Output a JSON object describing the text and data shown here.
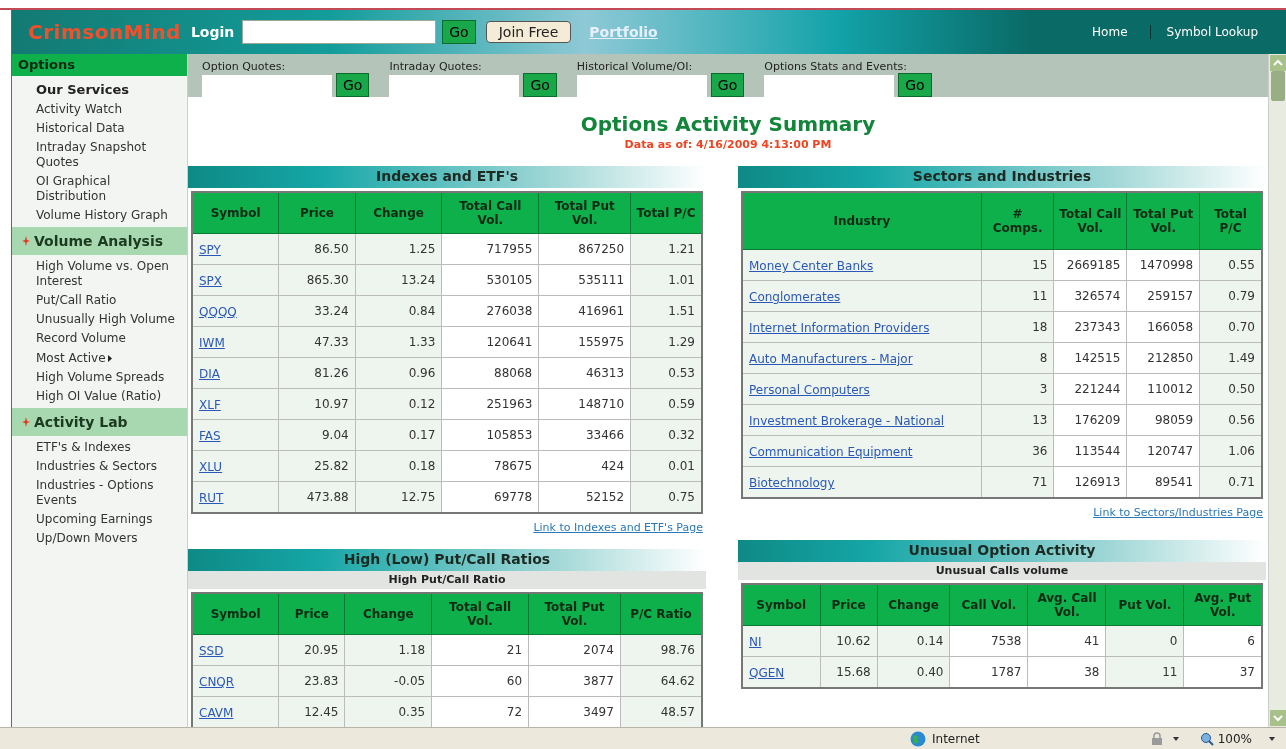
{
  "header": {
    "logo": "CrimsonMind",
    "login_label": "Login",
    "login_button": "Go",
    "join_button": "Join Free",
    "portfolio_link": "Portfolio",
    "nav_links": [
      "Home",
      "Symbol Lookup"
    ]
  },
  "sidebar": {
    "title": "Options",
    "items": [
      {
        "kind": "heading",
        "label": "Our Services"
      },
      {
        "kind": "link",
        "label": "Activity Watch"
      },
      {
        "kind": "link",
        "label": "Historical Data"
      },
      {
        "kind": "link",
        "label": "Intraday Snapshot Quotes"
      },
      {
        "kind": "link",
        "label": "OI Graphical Distribution"
      },
      {
        "kind": "link",
        "label": "Volume History Graph"
      },
      {
        "kind": "section",
        "label": "Volume Analysis"
      },
      {
        "kind": "link",
        "label": "High Volume vs. Open Interest"
      },
      {
        "kind": "link",
        "label": "Put/Call Ratio"
      },
      {
        "kind": "link",
        "label": "Unusually High Volume"
      },
      {
        "kind": "link",
        "label": "Record Volume"
      },
      {
        "kind": "submenu",
        "label": "Most Active"
      },
      {
        "kind": "link",
        "label": "High Volume Spreads"
      },
      {
        "kind": "link",
        "label": "High OI Value (Ratio)"
      },
      {
        "kind": "section",
        "label": "Activity Lab"
      },
      {
        "kind": "link",
        "label": "ETF's & Indexes"
      },
      {
        "kind": "link",
        "label": "Industries & Sectors"
      },
      {
        "kind": "link",
        "label": "Industries - Options Events"
      },
      {
        "kind": "link",
        "label": "Upcoming Earnings"
      },
      {
        "kind": "link",
        "label": "Up/Down Movers"
      }
    ]
  },
  "quote_bar": [
    {
      "label": "Option Quotes:",
      "button": "Go"
    },
    {
      "label": "Intraday Quotes:",
      "button": "Go"
    },
    {
      "label": "Historical Volume/OI:",
      "button": "Go"
    },
    {
      "label": "Options Stats and Events:",
      "button": "Go"
    }
  ],
  "summary": {
    "title": "Options Activity Summary",
    "date": "Data as of: 4/16/2009 4:13:00 PM"
  },
  "left_tables": [
    {
      "title": "Indexes and ETF's",
      "columns": [
        "Symbol",
        "Price",
        "Change",
        "Total Call Vol.",
        "Total Put Vol.",
        "Total P/C"
      ],
      "rows": [
        [
          "SPY",
          "86.50",
          "1.25",
          "717955",
          "867250",
          "1.21"
        ],
        [
          "SPX",
          "865.30",
          "13.24",
          "530105",
          "535111",
          "1.01"
        ],
        [
          "QQQQ",
          "33.24",
          "0.84",
          "276038",
          "416961",
          "1.51"
        ],
        [
          "IWM",
          "47.33",
          "1.33",
          "120641",
          "155975",
          "1.29"
        ],
        [
          "DIA",
          "81.26",
          "0.96",
          "88068",
          "46313",
          "0.53"
        ],
        [
          "XLF",
          "10.97",
          "0.12",
          "251963",
          "148710",
          "0.59"
        ],
        [
          "FAS",
          "9.04",
          "0.17",
          "105853",
          "33466",
          "0.32"
        ],
        [
          "XLU",
          "25.82",
          "0.18",
          "78675",
          "424",
          "0.01"
        ],
        [
          "RUT",
          "473.88",
          "12.75",
          "69778",
          "52152",
          "0.75"
        ]
      ],
      "link": "Link to Indexes and ETF's Page"
    },
    {
      "title": "High (Low) Put/Call Ratios",
      "subtitle": "High Put/Call Ratio",
      "columns": [
        "Symbol",
        "Price",
        "Change",
        "Total Call Vol.",
        "Total Put Vol.",
        "P/C Ratio"
      ],
      "rows": [
        [
          "SSD",
          "20.95",
          "1.18",
          "21",
          "2074",
          "98.76"
        ],
        [
          "CNQR",
          "23.83",
          "-0.05",
          "60",
          "3877",
          "64.62"
        ],
        [
          "CAVM",
          "12.45",
          "0.35",
          "72",
          "3497",
          "48.57"
        ]
      ]
    }
  ],
  "right_tables": [
    {
      "title": "Sectors and Industries",
      "columns": [
        "Industry",
        "# Comps.",
        "Total Call Vol.",
        "Total Put Vol.",
        "Total P/C"
      ],
      "rows": [
        [
          "Money Center Banks",
          "15",
          "2669185",
          "1470998",
          "0.55"
        ],
        [
          "Conglomerates",
          "11",
          "326574",
          "259157",
          "0.79"
        ],
        [
          "Internet Information Providers",
          "18",
          "237343",
          "166058",
          "0.70"
        ],
        [
          "Auto Manufacturers - Major",
          "8",
          "142515",
          "212850",
          "1.49"
        ],
        [
          "Personal Computers",
          "3",
          "221244",
          "110012",
          "0.50"
        ],
        [
          "Investment Brokerage - National",
          "13",
          "176209",
          "98059",
          "0.56"
        ],
        [
          "Communication Equipment",
          "36",
          "113544",
          "120747",
          "1.06"
        ],
        [
          "Biotechnology",
          "71",
          "126913",
          "89541",
          "0.71"
        ]
      ],
      "link": "Link to Sectors/Industries Page"
    },
    {
      "title": "Unusual Option Activity",
      "subtitle": "Unusual Calls volume",
      "columns": [
        "Symbol",
        "Price",
        "Change",
        "Call Vol.",
        "Avg. Call Vol.",
        "Put Vol.",
        "Avg. Put Vol."
      ],
      "rows": [
        [
          "NI",
          "10.62",
          "0.14",
          "7538",
          "41",
          "0",
          "6"
        ],
        [
          "QGEN",
          "15.68",
          "0.40",
          "1787",
          "38",
          "11",
          "37"
        ]
      ]
    }
  ],
  "status_bar": {
    "zone": "Internet",
    "zoom": "100%"
  }
}
